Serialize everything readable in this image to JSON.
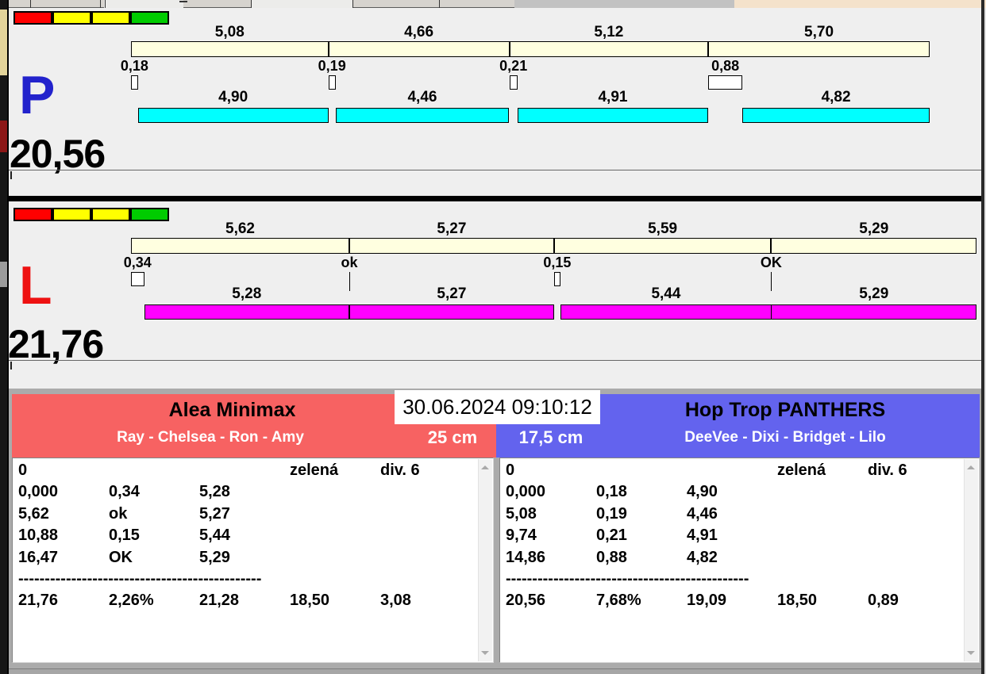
{
  "timestamp": "30.06.2024 09:10:12",
  "colors": {
    "background": "#EFEFEF",
    "split_bar": "#FFFFE0",
    "p_run_bar": "#00FFFF",
    "l_run_bar": "#FF00FF",
    "left_header": "#F76262",
    "right_header": "#6363EE",
    "p_letter": "#2222CC",
    "l_letter": "#EE1111",
    "panel_gray": "#ABABAB"
  },
  "runs": {
    "p": {
      "letter": "P",
      "letter_color": "#2222CC",
      "total": "20,56",
      "run_color": "#00FFFF",
      "lights": [
        "#FF0000",
        "#FFFF00",
        "#FFFF00",
        "#00CC00"
      ],
      "legs": [
        {
          "split": "5,08",
          "reaction": "0,18",
          "run": "4,90"
        },
        {
          "split": "4,66",
          "reaction": "0,19",
          "run": "4,46"
        },
        {
          "split": "5,12",
          "reaction": "0,21",
          "run": "4,91"
        },
        {
          "split": "5,70",
          "reaction": "0,88",
          "run": "4,82"
        }
      ]
    },
    "l": {
      "letter": "L",
      "letter_color": "#EE1111",
      "total": "21,76",
      "run_color": "#FF00FF",
      "lights": [
        "#FF0000",
        "#FFFF00",
        "#FFFF00",
        "#00CC00"
      ],
      "legs": [
        {
          "split": "5,62",
          "reaction": "0,34",
          "run": "5,28"
        },
        {
          "split": "5,27",
          "reaction": "ok",
          "run": "5,27"
        },
        {
          "split": "5,59",
          "reaction": "0,15",
          "run": "5,44"
        },
        {
          "split": "5,29",
          "reaction": "OK",
          "run": "5,29"
        }
      ]
    }
  },
  "teams": {
    "left": {
      "name": "Alea Minimax",
      "members": "Ray - Chelsea - Ron - Amy",
      "jump_height": "25 cm",
      "header_color": "#F76262",
      "rows": [
        [
          "0",
          "",
          "",
          "zelená",
          "div. 6"
        ],
        [
          "0,000",
          "0,34",
          "5,28",
          "",
          ""
        ],
        [
          "5,62",
          "ok",
          "5,27",
          "",
          ""
        ],
        [
          "10,88",
          "0,15",
          "5,44",
          "",
          ""
        ],
        [
          "16,47",
          "OK",
          "5,29",
          "",
          ""
        ]
      ],
      "separator": "----------------------------------------------",
      "totals": [
        "21,76",
        "2,26%",
        "21,28",
        "18,50",
        "3,08"
      ]
    },
    "right": {
      "name": "Hop Trop PANTHERS",
      "members": "DeeVee - Dixi - Bridget - Lilo",
      "jump_height": "17,5 cm",
      "header_color": "#6363EE",
      "rows": [
        [
          "0",
          "",
          "",
          "zelená",
          "div. 6"
        ],
        [
          "0,000",
          "0,18",
          "4,90",
          "",
          ""
        ],
        [
          "5,08",
          "0,19",
          "4,46",
          "",
          ""
        ],
        [
          "9,74",
          "0,21",
          "4,91",
          "",
          ""
        ],
        [
          "14,86",
          "0,88",
          "4,82",
          "",
          ""
        ]
      ],
      "separator": "----------------------------------------------",
      "totals": [
        "20,56",
        "7,68%",
        "19,09",
        "18,50",
        "0,89"
      ]
    }
  }
}
